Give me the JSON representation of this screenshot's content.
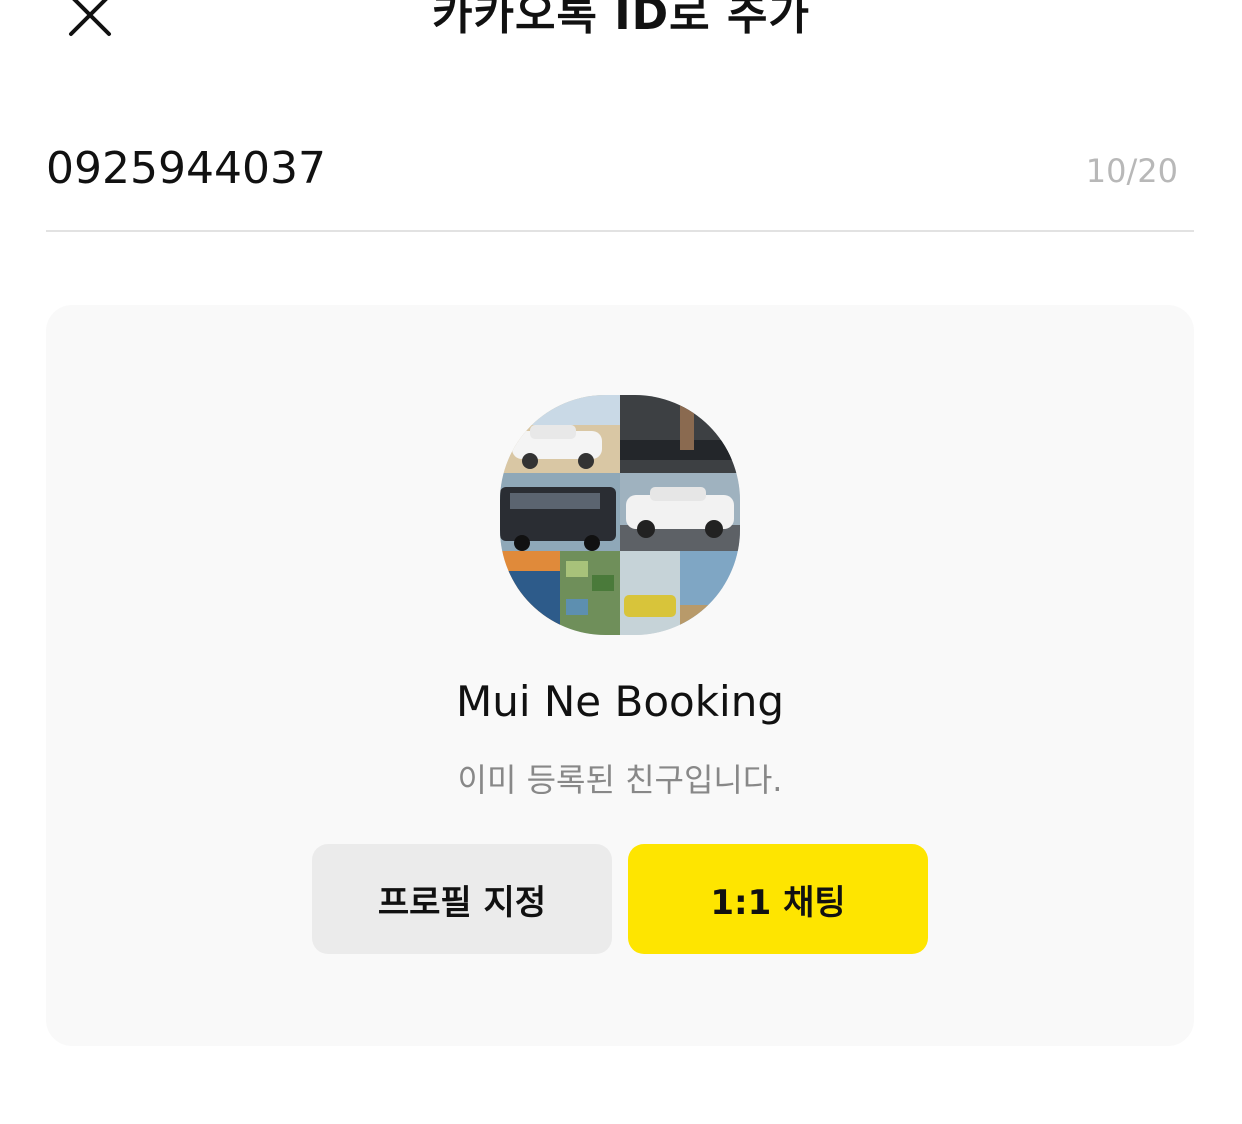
{
  "header": {
    "title": "카카오톡 ID로 추가",
    "close_icon": "close-icon"
  },
  "search": {
    "value": "0925944037",
    "counter": "10/20"
  },
  "result": {
    "name": "Mui Ne Booking",
    "status": "이미 등록된 친구입니다.",
    "profile_button": "프로필 지정",
    "chat_button": "1:1 채팅",
    "accent_color": "#fee500"
  }
}
